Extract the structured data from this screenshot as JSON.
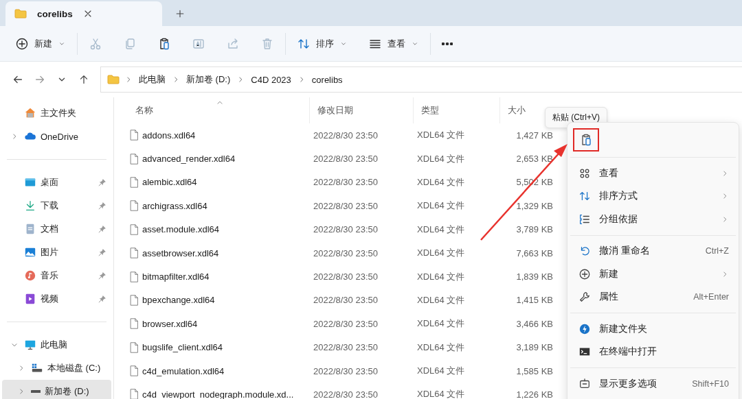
{
  "tabs": [
    {
      "label": "corelibs",
      "selected": true
    }
  ],
  "toolbar": {
    "groups": [
      {
        "items": [
          {
            "kind": "new",
            "label": "新建",
            "dropdown": true,
            "disabled": false
          }
        ]
      },
      {
        "items": [
          {
            "kind": "cut",
            "disabled": true
          },
          {
            "kind": "copy",
            "disabled": true
          },
          {
            "kind": "paste",
            "disabled": false
          },
          {
            "kind": "rename",
            "disabled": true
          },
          {
            "kind": "share",
            "disabled": true
          },
          {
            "kind": "delete",
            "disabled": true
          }
        ]
      },
      {
        "items": [
          {
            "kind": "sort",
            "label": "排序",
            "dropdown": true,
            "disabled": false
          },
          {
            "kind": "view",
            "label": "查看",
            "dropdown": true,
            "disabled": false
          }
        ]
      },
      {
        "items": [
          {
            "kind": "more",
            "disabled": false
          }
        ]
      }
    ]
  },
  "navigation": [
    {
      "kind": "back",
      "disabled": false
    },
    {
      "kind": "forward",
      "disabled": true
    },
    {
      "kind": "recent",
      "disabled": false
    },
    {
      "kind": "up",
      "disabled": false
    }
  ],
  "address": {
    "crumbs": [
      "此电脑",
      "新加卷 (D:)",
      "C4D 2023",
      "corelibs"
    ]
  },
  "sidebar": {
    "sections": [
      {
        "items": [
          {
            "kind": "home",
            "label": "主文件夹",
            "selected": false
          },
          {
            "kind": "cloud",
            "label": "OneDrive",
            "expanded": false,
            "selected": false
          }
        ]
      },
      {
        "items": [
          {
            "kind": "desktop",
            "label": "桌面",
            "pinned": true,
            "selected": false
          },
          {
            "kind": "download",
            "label": "下载",
            "pinned": true,
            "selected": false
          },
          {
            "kind": "document",
            "label": "文档",
            "pinned": true,
            "selected": false
          },
          {
            "kind": "picture",
            "label": "图片",
            "pinned": true,
            "selected": false
          },
          {
            "kind": "music",
            "label": "音乐",
            "pinned": true,
            "selected": false
          },
          {
            "kind": "video",
            "label": "视频",
            "pinned": true,
            "selected": false
          }
        ]
      },
      {
        "items": [
          {
            "kind": "computer",
            "label": "此电脑",
            "expanded": true,
            "selected": false,
            "children": [
              {
                "kind": "system-drive",
                "label": "本地磁盘 (C:)",
                "expanded": false,
                "selected": false
              },
              {
                "kind": "drive",
                "label": "新加卷 (D:)",
                "expanded": false,
                "selected": true
              }
            ]
          }
        ]
      }
    ]
  },
  "files": {
    "columns": [
      {
        "label": "名称",
        "sorted": true
      },
      {
        "label": "修改日期",
        "sorted": false
      },
      {
        "label": "类型",
        "sorted": false
      },
      {
        "label": "大小",
        "sorted": false
      }
    ],
    "rows": [
      {
        "name": "addons.xdl64",
        "modified": "2022/8/30 23:50",
        "type": "XDL64 文件",
        "size": "1,427 KB"
      },
      {
        "name": "advanced_render.xdl64",
        "modified": "2022/8/30 23:50",
        "type": "XDL64 文件",
        "size": "2,653 KB"
      },
      {
        "name": "alembic.xdl64",
        "modified": "2022/8/30 23:50",
        "type": "XDL64 文件",
        "size": "5,502 KB"
      },
      {
        "name": "archigrass.xdl64",
        "modified": "2022/8/30 23:50",
        "type": "XDL64 文件",
        "size": "1,329 KB"
      },
      {
        "name": "asset.module.xdl64",
        "modified": "2022/8/30 23:50",
        "type": "XDL64 文件",
        "size": "3,789 KB"
      },
      {
        "name": "assetbrowser.xdl64",
        "modified": "2022/8/30 23:50",
        "type": "XDL64 文件",
        "size": "7,663 KB"
      },
      {
        "name": "bitmapfilter.xdl64",
        "modified": "2022/8/30 23:50",
        "type": "XDL64 文件",
        "size": "1,839 KB"
      },
      {
        "name": "bpexchange.xdl64",
        "modified": "2022/8/30 23:50",
        "type": "XDL64 文件",
        "size": "1,415 KB"
      },
      {
        "name": "browser.xdl64",
        "modified": "2022/8/30 23:50",
        "type": "XDL64 文件",
        "size": "3,466 KB"
      },
      {
        "name": "bugslife_client.xdl64",
        "modified": "2022/8/30 23:50",
        "type": "XDL64 文件",
        "size": "3,189 KB"
      },
      {
        "name": "c4d_emulation.xdl64",
        "modified": "2022/8/30 23:50",
        "type": "XDL64 文件",
        "size": "1,585 KB"
      },
      {
        "name": "c4d_viewport_nodegraph.module.xd...",
        "modified": "2022/8/30 23:50",
        "type": "XDL64 文件",
        "size": "1,226 KB"
      }
    ]
  },
  "context_menu": {
    "tooltip": "粘贴 (Ctrl+V)",
    "top_actions": [
      {
        "kind": "paste",
        "highlighted": true
      }
    ],
    "sections": [
      {
        "items": [
          {
            "kind": "view",
            "label": "查看",
            "submenu": true
          },
          {
            "kind": "sort",
            "label": "排序方式",
            "submenu": true
          },
          {
            "kind": "group",
            "label": "分组依据",
            "submenu": true
          }
        ]
      },
      {
        "items": [
          {
            "kind": "undo",
            "label": "撤消 重命名",
            "shortcut": "Ctrl+Z",
            "submenu": false
          },
          {
            "kind": "new",
            "label": "新建",
            "submenu": true
          },
          {
            "kind": "properties",
            "label": "属性",
            "shortcut": "Alt+Enter",
            "submenu": false
          }
        ]
      },
      {
        "items": [
          {
            "kind": "new-folder",
            "label": "新建文件夹",
            "submenu": false
          },
          {
            "kind": "terminal",
            "label": "在终端中打开",
            "submenu": false
          }
        ]
      },
      {
        "items": [
          {
            "kind": "more-options",
            "label": "显示更多选项",
            "shortcut": "Shift+F10",
            "submenu": false
          }
        ]
      }
    ]
  }
}
